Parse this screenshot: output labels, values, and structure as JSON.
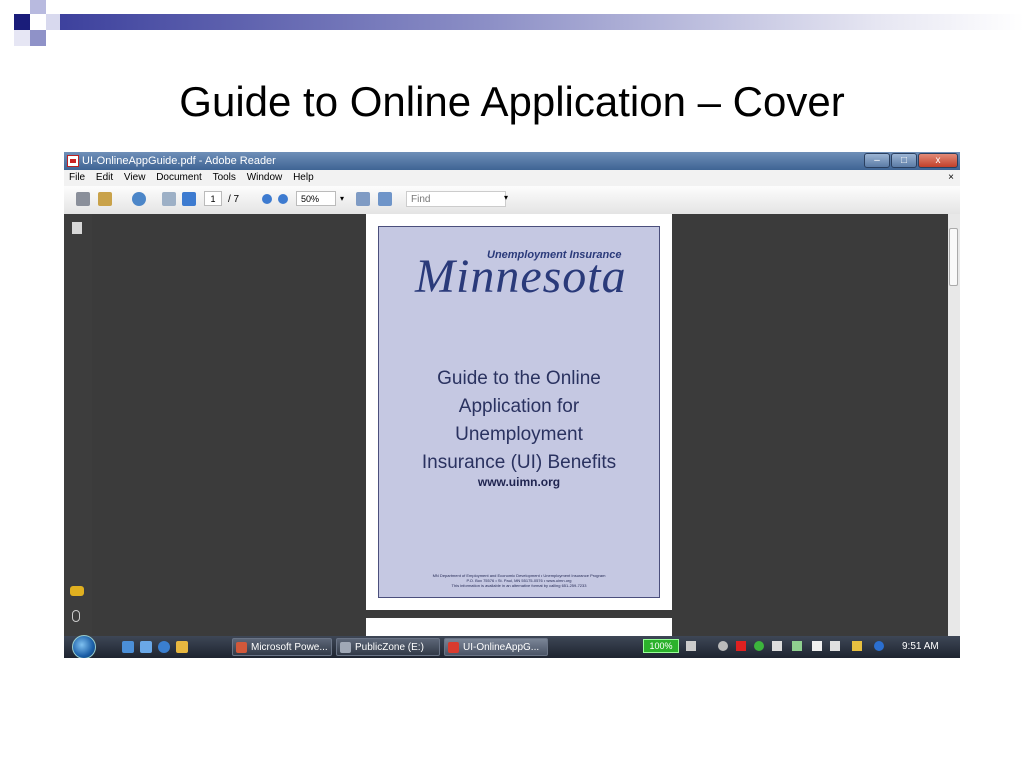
{
  "slide": {
    "title": "Guide to Online Application – Cover"
  },
  "window": {
    "title": "UI-OnlineAppGuide.pdf - Adobe Reader",
    "minimize": "–",
    "maximize": "□",
    "close": "x",
    "menu": [
      "File",
      "Edit",
      "View",
      "Document",
      "Tools",
      "Window",
      "Help"
    ],
    "menu_close": "×"
  },
  "toolbar": {
    "page_current": "1",
    "page_total": "/ 7",
    "zoom": "50%",
    "find_placeholder": "Find",
    "find_arrow": "▾",
    "zoom_arrow": "▾"
  },
  "document": {
    "ui_heading": "Unemployment Insurance",
    "state": "Minnesota",
    "guide_lines": [
      "Guide to the Online",
      "Application for",
      "Unemployment",
      "Insurance (UI) Benefits"
    ],
    "url": "www.uimn.org",
    "fine_print": [
      "MN Department of Employment and Economic Development • Unemployment Insurance Program",
      "P.O. Box 75576 • St. Paul, MN 55175-0576 • www.uimn.org",
      "This information is available in an alternative format by calling 651-259-7233"
    ]
  },
  "taskbar": {
    "tasks": [
      "Microsoft Powe...",
      "PublicZone (E:)",
      "UI-OnlineAppG..."
    ],
    "battery": "100%",
    "clock": "9:51 AM"
  },
  "colors": {
    "slide_accent": "#3b3f9c",
    "cover_bg": "#c5c8e2",
    "cover_text": "#2a3a7a",
    "battery": "#2bb12b"
  },
  "icons": [
    "print-icon",
    "email-icon",
    "globe-icon",
    "up-arrow-icon",
    "down-arrow-icon",
    "zoom-out-icon",
    "zoom-in-icon",
    "save-icon",
    "fit-icon",
    "pages-icon",
    "comment-icon",
    "attachment-icon",
    "start-icon"
  ]
}
